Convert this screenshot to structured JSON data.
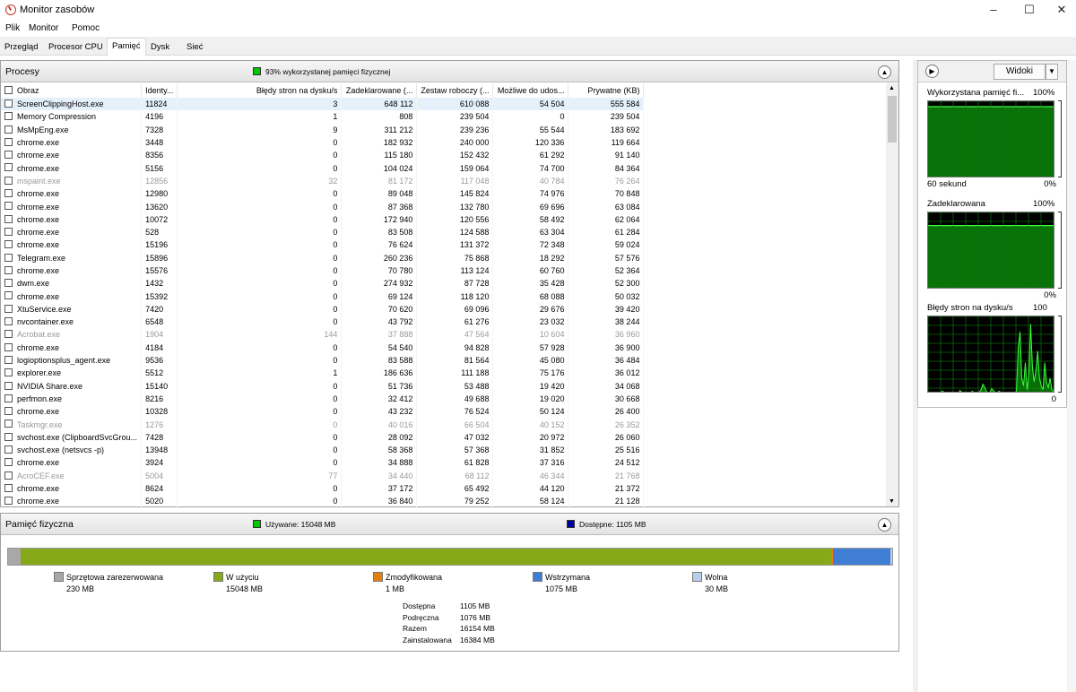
{
  "window": {
    "title": "Monitor zasobów",
    "minimize": "–",
    "maximize": "☐",
    "close": "✕"
  },
  "menu": [
    "Plik",
    "Monitor",
    "Pomoc"
  ],
  "tabs": [
    "Przegląd",
    "Procesor CPU",
    "Pamięć",
    "Dysk",
    "Sieć"
  ],
  "processes": {
    "title": "Procesy",
    "summary": "93% wykorzystanej pamięci fizycznej",
    "summary_color": "#00c800",
    "columns": [
      "Obraz",
      "Identy...",
      "Błędy stron na dysku/s",
      "Zadeklarowane (...",
      "Zestaw roboczy (...",
      "Możliwe do udos...",
      "Prywatne (KB)"
    ],
    "rows": [
      [
        "ScreenClippingHost.exe",
        "11824",
        "3",
        "648 112",
        "610 088",
        "54 504",
        "555 584",
        "sel"
      ],
      [
        "Memory Compression",
        "4196",
        "1",
        "808",
        "239 504",
        "0",
        "239 504",
        ""
      ],
      [
        "MsMpEng.exe",
        "7328",
        "9",
        "311 212",
        "239 236",
        "55 544",
        "183 692",
        ""
      ],
      [
        "chrome.exe",
        "3448",
        "0",
        "182 932",
        "240 000",
        "120 336",
        "119 664",
        ""
      ],
      [
        "chrome.exe",
        "8356",
        "0",
        "115 180",
        "152 432",
        "61 292",
        "91 140",
        ""
      ],
      [
        "chrome.exe",
        "5156",
        "0",
        "104 024",
        "159 064",
        "74 700",
        "84 364",
        ""
      ],
      [
        "mspaint.exe",
        "12856",
        "32",
        "81 172",
        "117 048",
        "40 784",
        "76 264",
        "dim"
      ],
      [
        "chrome.exe",
        "12980",
        "0",
        "89 048",
        "145 824",
        "74 976",
        "70 848",
        ""
      ],
      [
        "chrome.exe",
        "13620",
        "0",
        "87 368",
        "132 780",
        "69 696",
        "63 084",
        ""
      ],
      [
        "chrome.exe",
        "10072",
        "0",
        "172 940",
        "120 556",
        "58 492",
        "62 064",
        ""
      ],
      [
        "chrome.exe",
        "528",
        "0",
        "83 508",
        "124 588",
        "63 304",
        "61 284",
        ""
      ],
      [
        "chrome.exe",
        "15196",
        "0",
        "76 624",
        "131 372",
        "72 348",
        "59 024",
        ""
      ],
      [
        "Telegram.exe",
        "15896",
        "0",
        "260 236",
        "75 868",
        "18 292",
        "57 576",
        ""
      ],
      [
        "chrome.exe",
        "15576",
        "0",
        "70 780",
        "113 124",
        "60 760",
        "52 364",
        ""
      ],
      [
        "dwm.exe",
        "1432",
        "0",
        "274 932",
        "87 728",
        "35 428",
        "52 300",
        ""
      ],
      [
        "chrome.exe",
        "15392",
        "0",
        "69 124",
        "118 120",
        "68 088",
        "50 032",
        ""
      ],
      [
        "XtuService.exe",
        "7420",
        "0",
        "70 620",
        "69 096",
        "29 676",
        "39 420",
        ""
      ],
      [
        "nvcontainer.exe",
        "6548",
        "0",
        "43 792",
        "61 276",
        "23 032",
        "38 244",
        ""
      ],
      [
        "Acrobat.exe",
        "1904",
        "144",
        "37 888",
        "47 564",
        "10 604",
        "36 960",
        "dim"
      ],
      [
        "chrome.exe",
        "4184",
        "0",
        "54 540",
        "94 828",
        "57 928",
        "36 900",
        ""
      ],
      [
        "logioptionsplus_agent.exe",
        "9536",
        "0",
        "83 588",
        "81 564",
        "45 080",
        "36 484",
        ""
      ],
      [
        "explorer.exe",
        "5512",
        "1",
        "186 636",
        "111 188",
        "75 176",
        "36 012",
        ""
      ],
      [
        "NVIDIA Share.exe",
        "15140",
        "0",
        "51 736",
        "53 488",
        "19 420",
        "34 068",
        ""
      ],
      [
        "perfmon.exe",
        "8216",
        "0",
        "32 412",
        "49 688",
        "19 020",
        "30 668",
        ""
      ],
      [
        "chrome.exe",
        "10328",
        "0",
        "43 232",
        "76 524",
        "50 124",
        "26 400",
        ""
      ],
      [
        "Taskmgr.exe",
        "1276",
        "0",
        "40 016",
        "66 504",
        "40 152",
        "26 352",
        "dim"
      ],
      [
        "svchost.exe (ClipboardSvcGrou...",
        "7428",
        "0",
        "28 092",
        "47 032",
        "20 972",
        "26 060",
        ""
      ],
      [
        "svchost.exe (netsvcs -p)",
        "13948",
        "0",
        "58 368",
        "57 368",
        "31 852",
        "25 516",
        ""
      ],
      [
        "chrome.exe",
        "3924",
        "0",
        "34 888",
        "61 828",
        "37 316",
        "24 512",
        ""
      ],
      [
        "AcroCEF.exe",
        "5004",
        "77",
        "34 440",
        "68 112",
        "46 344",
        "21 768",
        "dim"
      ],
      [
        "chrome.exe",
        "8624",
        "0",
        "37 172",
        "65 492",
        "44 120",
        "21 372",
        ""
      ],
      [
        "chrome.exe",
        "5020",
        "0",
        "36 840",
        "79 252",
        "58 124",
        "21 128",
        ""
      ]
    ]
  },
  "physical": {
    "title": "Pamięć fizyczna",
    "used_label": "Używane: 15048 MB",
    "used_color": "#00c800",
    "avail_label": "Dostępne: 1105 MB",
    "avail_color": "#0000a0",
    "bar": [
      {
        "name": "Sprzętowa zarezerwowana",
        "value": "230 MB",
        "mb": 230,
        "color": "#a8a8a8"
      },
      {
        "name": "W użyciu",
        "value": "15048 MB",
        "mb": 15048,
        "color": "#86a919"
      },
      {
        "name": "Zmodyfikowana",
        "value": "1 MB",
        "mb": 1,
        "color": "#e47f12"
      },
      {
        "name": "Wstrzymana",
        "value": "1075 MB",
        "mb": 1075,
        "color": "#3f7ed3"
      },
      {
        "name": "Wolna",
        "value": "30 MB",
        "mb": 30,
        "color": "#b7cde9"
      }
    ],
    "stats": [
      [
        "Dostępna",
        "1105 MB"
      ],
      [
        "Podręczna",
        "1076 MB"
      ],
      [
        "Razem",
        "16154 MB"
      ],
      [
        "Zainstalowana",
        "16384 MB"
      ]
    ]
  },
  "side": {
    "views_label": "Widoki",
    "graphs": [
      {
        "title": "Wykorzystana pamięć fi...",
        "max": "100%",
        "footer_left": "60 sekund",
        "footer_right": "0%",
        "level": 0.93
      },
      {
        "title": "Zadeklarowana",
        "max": "100%",
        "footer_left": "",
        "footer_right": "0%",
        "level": 0.83
      },
      {
        "title": "Błędy stron na dysku/s",
        "max": "100",
        "footer_left": "",
        "footer_right": "0",
        "level": 0.1
      }
    ]
  }
}
